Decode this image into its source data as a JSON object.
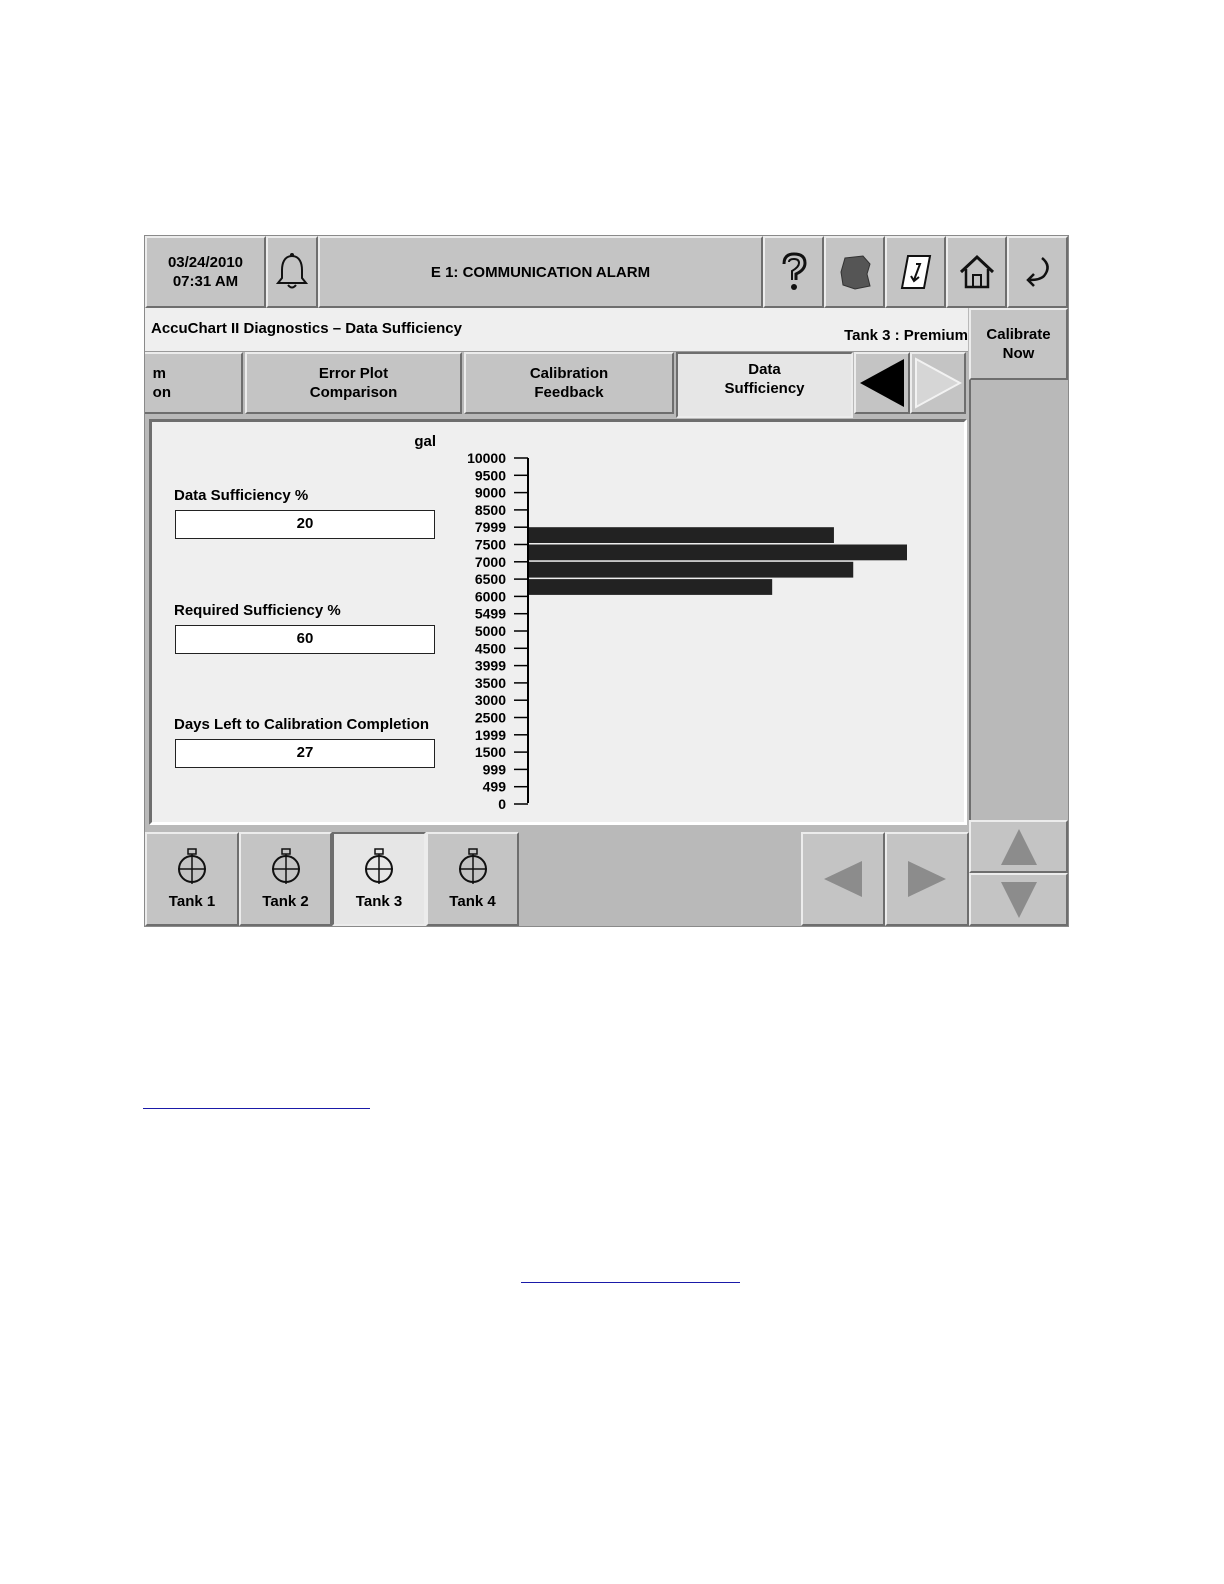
{
  "status_bar": {
    "date": "03/24/2010",
    "time": "07:31 AM",
    "alarm_message": "E 1: COMMUNICATION ALARM"
  },
  "toolbar_icons": [
    "bell-icon",
    "help-icon",
    "map-icon",
    "report-icon",
    "home-icon",
    "back-icon"
  ],
  "header": {
    "title": "AccuChart II Diagnostics – Data Sufficiency",
    "tank_label": "Tank 3 : Premium"
  },
  "calibrate_button": "Calibrate\nNow",
  "tabs": [
    {
      "label": "m\non",
      "selected": false
    },
    {
      "label": "Error Plot\nComparison",
      "selected": false
    },
    {
      "label": "Calibration\nFeedback",
      "selected": false
    },
    {
      "label": "Data\nSufficiency",
      "selected": true
    }
  ],
  "fields": {
    "data_sufficiency_label": "Data Sufficiency %",
    "data_sufficiency_value": "20",
    "required_sufficiency_label": "Required Sufficiency %",
    "required_sufficiency_value": "60",
    "days_left_label": "Days Left to Calibration Completion",
    "days_left_value": "27"
  },
  "chart_data": {
    "type": "bar",
    "orientation": "horizontal",
    "unit_label": "gal",
    "tick_labels": [
      "10000",
      "9500",
      "9000",
      "8500",
      "7999",
      "7500",
      "7000",
      "6500",
      "6000",
      "5499",
      "5000",
      "4500",
      "3999",
      "3500",
      "3000",
      "2500",
      "1999",
      "1500",
      "999",
      "499",
      "0"
    ],
    "bars": [
      {
        "volume_band": "7500-7999",
        "relative_length": 0.79
      },
      {
        "volume_band": "7000-7500",
        "relative_length": 1.0
      },
      {
        "volume_band": "6500-7000",
        "relative_length": 0.84
      },
      {
        "volume_band": "6000-6500",
        "relative_length": 0.63
      }
    ],
    "bar_color": "#222222"
  },
  "tanks": [
    {
      "label": "Tank 1",
      "selected": false
    },
    {
      "label": "Tank 2",
      "selected": false
    },
    {
      "label": "Tank 3",
      "selected": true
    },
    {
      "label": "Tank 4",
      "selected": false
    }
  ]
}
